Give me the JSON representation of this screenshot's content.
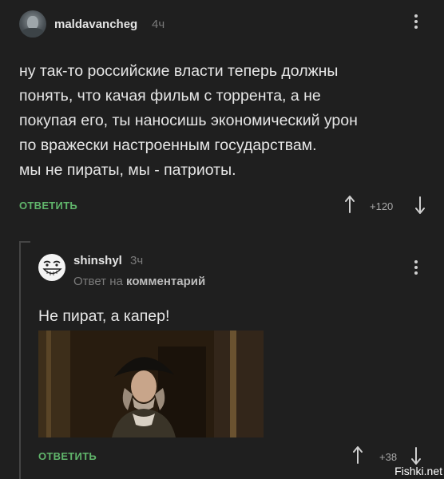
{
  "post": {
    "author": "maldavancheg",
    "time": "4ч",
    "lines": [
      "ну так-то российские власти теперь должны",
      "понять, что качая фильм с торрента, а не",
      "покупая его, ты наносишь экономический урон",
      "по вражески настроенным государствам.",
      "мы не пираты, мы - патриоты."
    ],
    "reply_label": "ОТВЕТИТЬ",
    "rating": "+120"
  },
  "reply": {
    "author": "shinshyl",
    "time": "3ч",
    "reply_prefix": "Ответ на",
    "reply_target": "комментарий",
    "text": "Не пират, а капер!",
    "reply_label": "ОТВЕТИТЬ",
    "rating": "+38"
  },
  "watermark": "Fishki.net",
  "colors": {
    "accent": "#60b56b",
    "background": "#1f1f1f"
  },
  "icons": [
    "user-avatar-icon",
    "more-vertical-icon",
    "upvote-arrow-icon",
    "downvote-arrow-icon",
    "troll-face-avatar-icon"
  ]
}
